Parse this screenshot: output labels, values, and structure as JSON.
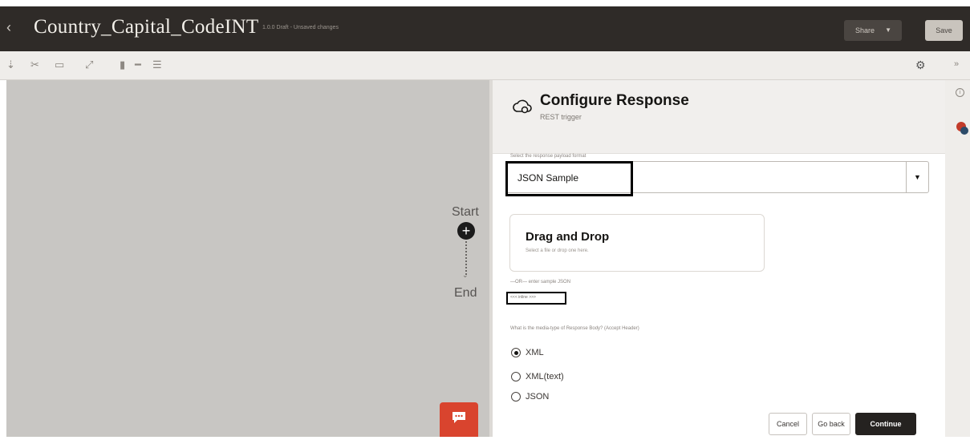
{
  "header": {
    "back_glyph": "‹",
    "title": "Country_Capital_CodeINT",
    "status": "1.0.0 Draft - Unsaved changes",
    "share_label": "Share",
    "save_label": "Save"
  },
  "canvas": {
    "start_label": "Start",
    "end_label": "End",
    "chat_glyph": "💬"
  },
  "panel": {
    "title": "Configure Response",
    "subtitle": "REST trigger",
    "format_label": "Select the response payload format",
    "format_value": "JSON Sample",
    "dnd_title": "Drag and Drop",
    "dnd_subtitle": "Select a file or drop one here.",
    "or_text": "—OR— enter sample JSON",
    "inline_link": "<<< inline >>>",
    "media_label": "What is the media-type of Response Body? (Accept Header)",
    "media_options": [
      {
        "label": "XML",
        "selected": true
      },
      {
        "label": "XML(text)",
        "selected": false
      },
      {
        "label": "JSON",
        "selected": false
      }
    ],
    "buttons": {
      "cancel": "Cancel",
      "go_back": "Go back",
      "continue": "Continue"
    }
  },
  "colors": {
    "header_bg": "#2f2b28",
    "canvas_bg": "#c8c6c3",
    "chat_accent": "#d9442e"
  }
}
